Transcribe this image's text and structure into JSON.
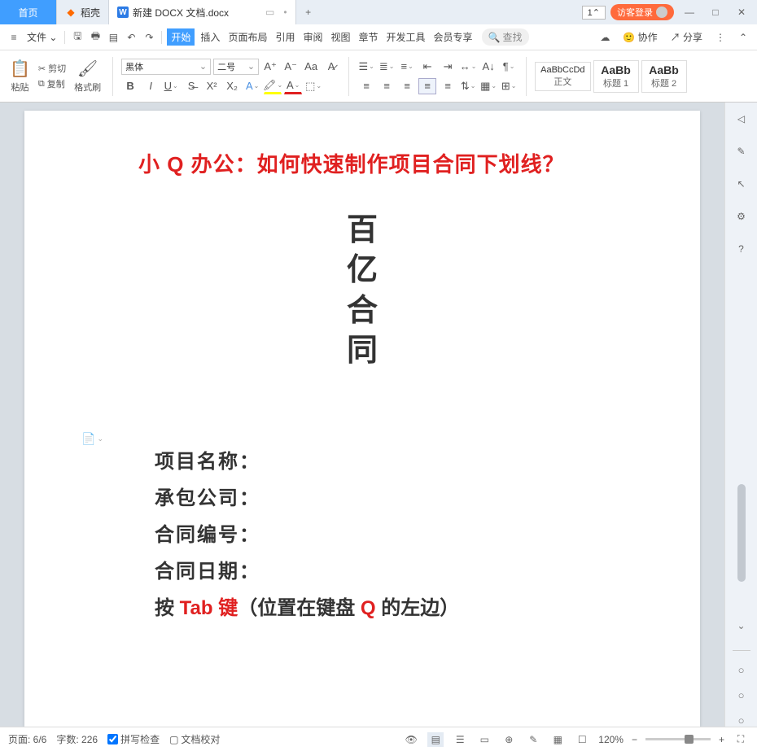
{
  "titlebar": {
    "home": "首页",
    "dk": "稻壳",
    "doc": "新建 DOCX 文档.docx",
    "page_indicator": "1",
    "login": "访客登录"
  },
  "menubar": {
    "file": "文件",
    "items": [
      "开始",
      "插入",
      "页面布局",
      "引用",
      "审阅",
      "视图",
      "章节",
      "开发工具",
      "会员专享"
    ],
    "search": "查找",
    "collab": "协作",
    "share": "分享"
  },
  "ribbon": {
    "paste": "粘贴",
    "cut": "剪切",
    "copy": "复制",
    "fmtpaint": "格式刷",
    "font_name": "黑体",
    "font_size": "二号",
    "styles": [
      {
        "prev": "AaBbCcDd",
        "label": "正文"
      },
      {
        "prev": "AaBb",
        "label": "标题 1"
      },
      {
        "prev": "AaBb",
        "label": "标题 2"
      }
    ]
  },
  "doc": {
    "title_red": "小 Q 办公：如何快速制作项目合同下划线？",
    "big1": "百",
    "big2": "亿",
    "big3": "合",
    "big4": "同",
    "fields": [
      "项目名称：",
      "承包公司：",
      "合同编号：",
      "合同日期："
    ],
    "hint_pre": "按 ",
    "hint_tab": "Tab 键",
    "hint_mid": "（位置在键盘 ",
    "hint_q": "Q",
    "hint_post": " 的左边）"
  },
  "status": {
    "page": "页面: 6/6",
    "words": "字数: 226",
    "spell": "拼写检查",
    "proof": "文档校对",
    "zoom": "120%"
  }
}
